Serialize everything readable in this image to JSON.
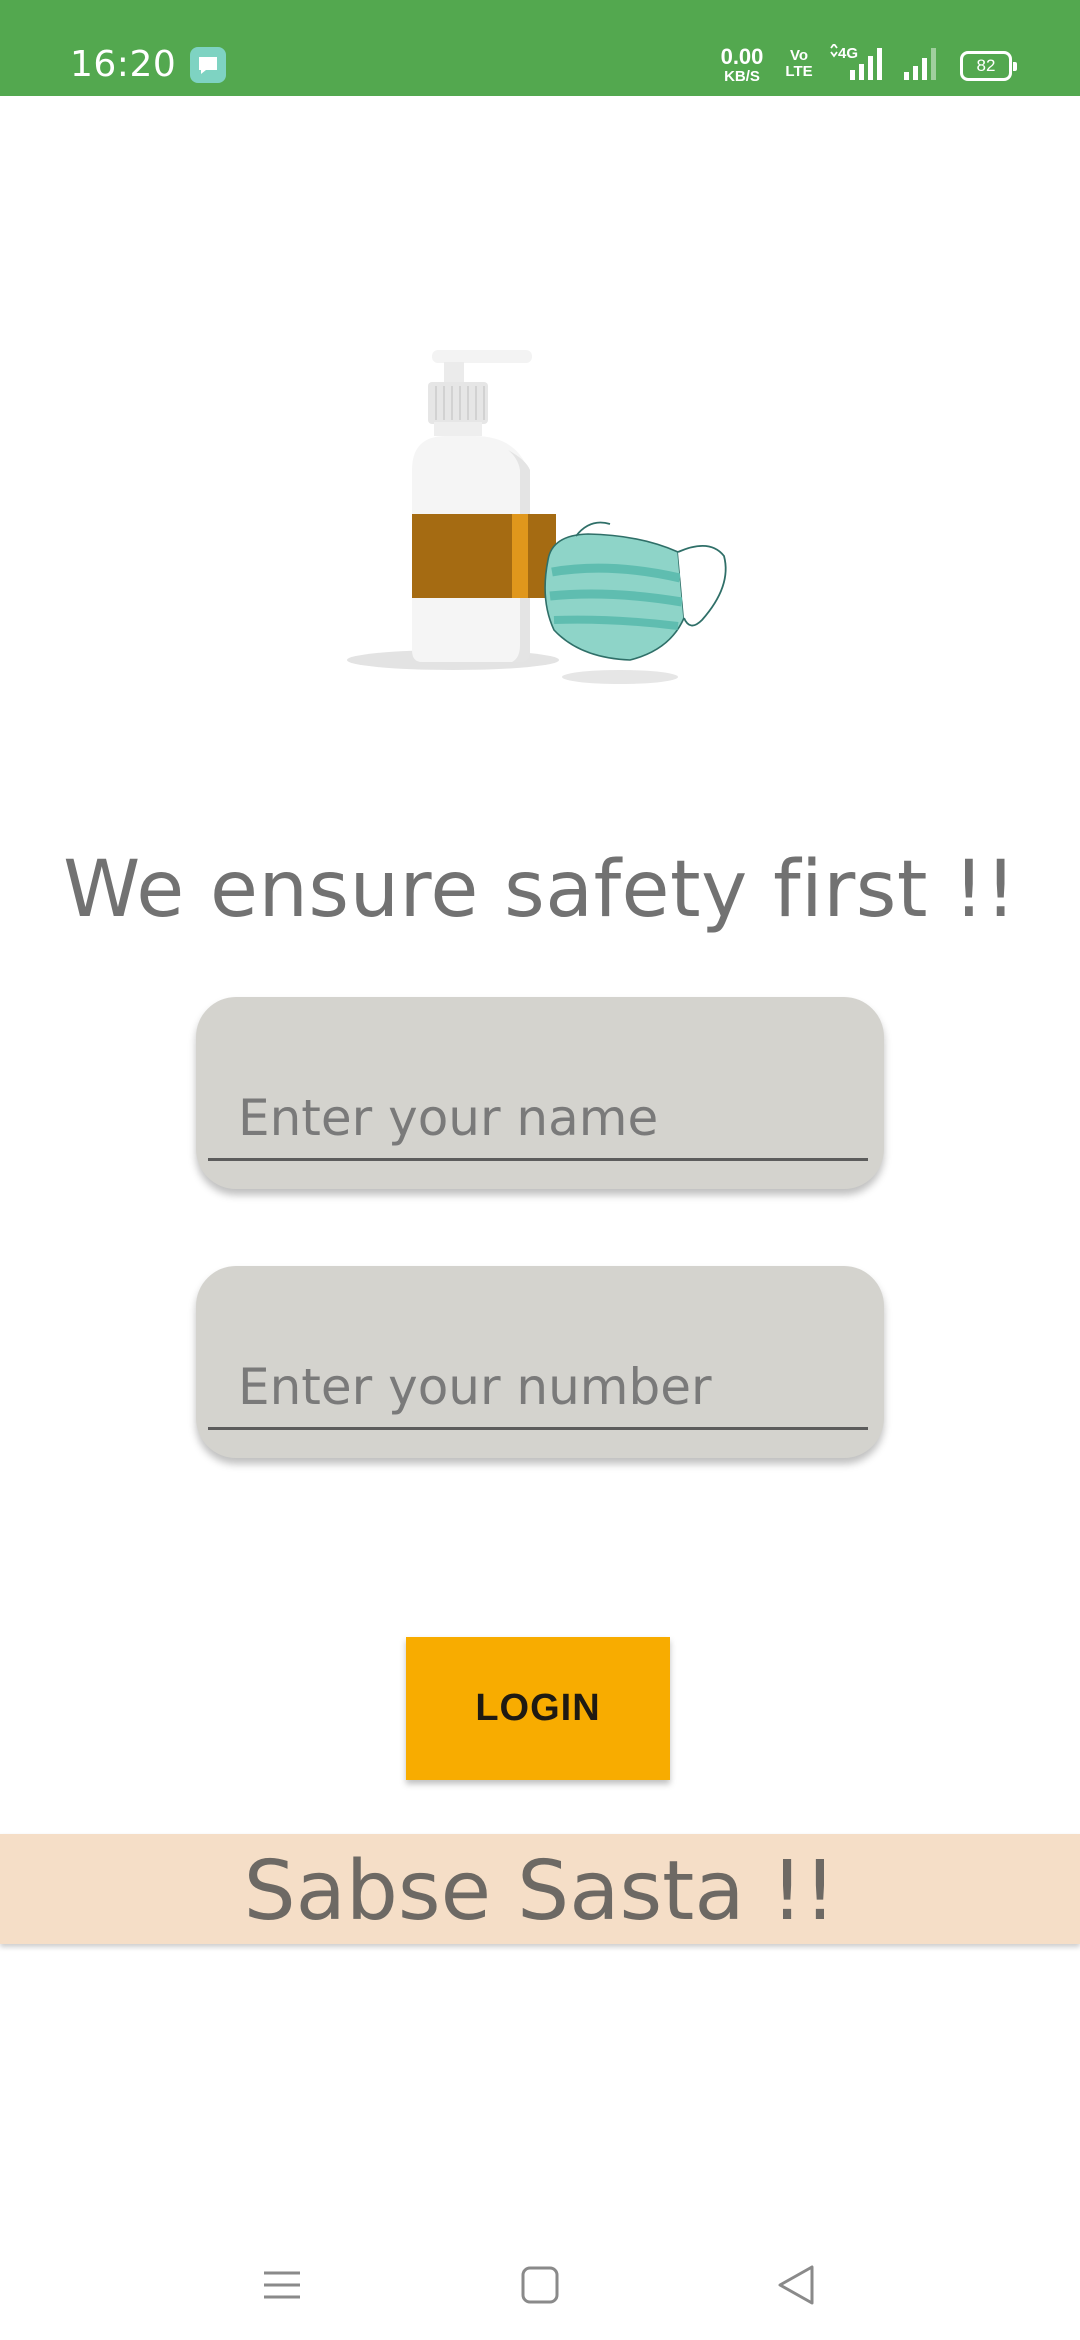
{
  "status_bar": {
    "time": "16:20",
    "net_speed_value": "0.00",
    "net_speed_unit": "KB/S",
    "volte_top": "Vo",
    "volte_bottom": "LTE",
    "network_type": "4G",
    "battery": "82",
    "color": "#53a84f"
  },
  "main": {
    "illustration": "sanitizer-and-mask-illustration",
    "headline": "We ensure safety first !!",
    "name_field": {
      "placeholder": "Enter your name",
      "value": ""
    },
    "number_field": {
      "placeholder": "Enter your number",
      "value": ""
    },
    "login_label": "LOGIN",
    "login_color": "#f8ac00",
    "banner": "Sabse Sasta !!",
    "banner_color": "#f5dec7"
  },
  "nav_bar": {
    "items": [
      {
        "icon": "menu-icon"
      },
      {
        "icon": "home-square-icon"
      },
      {
        "icon": "back-triangle-icon"
      }
    ]
  }
}
